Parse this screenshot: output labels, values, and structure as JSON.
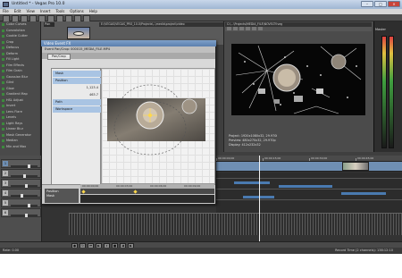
{
  "window": {
    "title": "Untitled * - Vegas Pro 10.0"
  },
  "menu": [
    "File",
    "Edit",
    "View",
    "Insert",
    "Tools",
    "Options",
    "Help"
  ],
  "explorer": {
    "items": [
      "Color Curves",
      "Convolution",
      "Cookie Cutter",
      "Crop",
      "Defocus",
      "Deform",
      "Fill Light",
      "Film Effects",
      "Film Grain",
      "Gaussian Blur",
      "Glint",
      "Glow",
      "Gradient Map",
      "HSL Adjust",
      "Invert",
      "Lens Flare",
      "Levels",
      "Light Rays",
      "Linear Blur",
      "Mask Generator",
      "Median",
      "Min and Max",
      "Mirror",
      "Newsprint",
      "Pixelate",
      "Quick Blur",
      "Radial Blur",
      "Sepia",
      "Sharpen",
      "Soft Contrast",
      "Spherize",
      "Starburst",
      "Swirl",
      "Threshold",
      "TV Simulator",
      "Wave",
      "Add Noise"
    ]
  },
  "file_browser": {
    "path": "Pan",
    "path_full": "E:\\VEGAS\\VEGAS_PRO_10.0\\Projects\\..\\media\\project\\video"
  },
  "dialog": {
    "title": "Video Event FX",
    "toolbar_text": "Event Pan/Crop: 000015_MEDIA_FILE.MP4",
    "tab": "Pan/Crop",
    "panel_rows": [
      {
        "label": "Mask",
        "kind": "header"
      },
      {
        "label": "Position",
        "kind": "header"
      },
      {
        "label": "1,123.4",
        "kind": "value"
      },
      {
        "label": "463.7",
        "kind": "value"
      },
      {
        "label": "Path",
        "kind": "header"
      },
      {
        "label": "Workspace",
        "kind": "header"
      }
    ],
    "timeline_label": "Position",
    "timeline_sublabel": "Mask",
    "ruler_ticks": [
      "00:00:00;00",
      "00:00:03;00",
      "00:00:06;00",
      "00:00:09;00"
    ]
  },
  "preview": {
    "path": "C:\\...\\Projects\\MEDIA_FILE\\NOVELTY.veg",
    "info_lines": [
      "Project: 1920x1080x32, 29.970i",
      "Preview: 480x270x32, 29.970p",
      "Display: 412x232x32"
    ],
    "frame_label": "Frame: 143"
  },
  "master": {
    "label": "Master"
  },
  "tracks": [
    {
      "num": "1",
      "fader": 0.7
    },
    {
      "num": "2",
      "fader": 0.5
    },
    {
      "num": "3",
      "fader": 0.6
    },
    {
      "num": "4",
      "fader": 0.4
    },
    {
      "num": "5",
      "fader": 0.7
    },
    {
      "num": "6",
      "fader": 0.6
    }
  ],
  "timeline": {
    "ticks": [
      "00:00:00;00",
      "00:00:15;00",
      "00:00:30;00",
      "00:00:45;00"
    ]
  },
  "status": {
    "left": "Rate: 0.00",
    "right": "Record Time (2 channels): 138:12:10"
  },
  "colors": {
    "selection": "#a9c4e3",
    "video_track": "#6f8fb3",
    "keyframe": "#ffd84a"
  },
  "icons": [
    "app-icon",
    "minimize-icon",
    "maximize-icon",
    "close-icon",
    "play-icon",
    "stop-icon",
    "record-icon",
    "loop-icon"
  ]
}
